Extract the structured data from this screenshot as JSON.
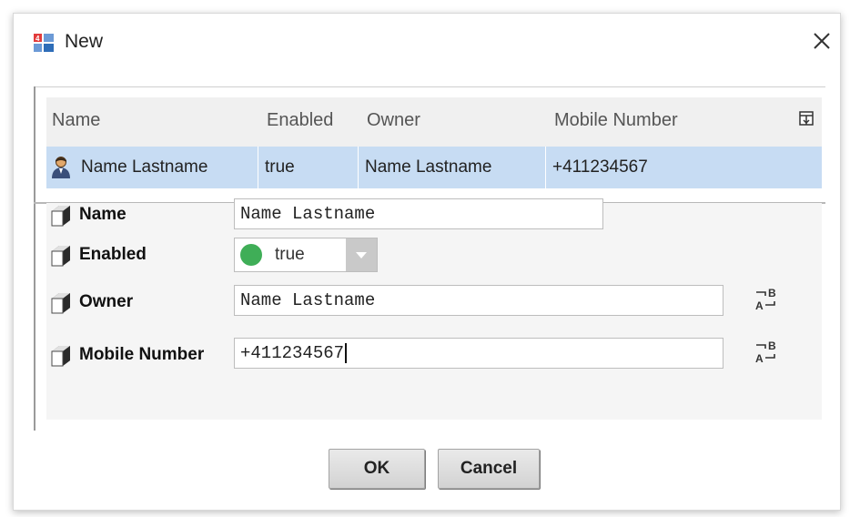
{
  "window": {
    "title": "New",
    "icon": "app-icon",
    "close_icon": "close-icon"
  },
  "table": {
    "columns": [
      "Name",
      "Enabled",
      "Owner",
      "Mobile Number"
    ],
    "column_chooser_icon": "column-chooser-icon",
    "rows": [
      {
        "icon": "user-icon",
        "name": "Name Lastname",
        "enabled": "true",
        "owner": "Name Lastname",
        "mobile": "+411234567"
      }
    ],
    "selected_row_color": "#c7dcf3"
  },
  "properties": {
    "name": {
      "label": "Name",
      "value": "Name Lastname"
    },
    "enabled": {
      "label": "Enabled",
      "value": "true",
      "status_color": "#3fae57"
    },
    "owner": {
      "label": "Owner",
      "value": "Name Lastname"
    },
    "mobile": {
      "label": "Mobile Number",
      "value": "+411234567"
    }
  },
  "buttons": {
    "ok": "OK",
    "cancel": "Cancel"
  }
}
